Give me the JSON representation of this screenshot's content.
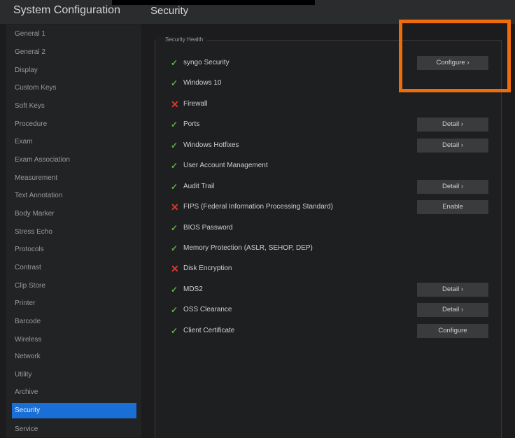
{
  "header": {
    "app_title": "System Configuration",
    "page_title": "Security"
  },
  "sidebar": {
    "active_index": 22,
    "items": [
      {
        "label": "General 1"
      },
      {
        "label": "General 2"
      },
      {
        "label": "Display"
      },
      {
        "label": "Custom Keys"
      },
      {
        "label": "Soft Keys"
      },
      {
        "label": "Procedure"
      },
      {
        "label": "Exam"
      },
      {
        "label": "Exam Association"
      },
      {
        "label": "Measurement"
      },
      {
        "label": "Text Annotation"
      },
      {
        "label": "Body Marker"
      },
      {
        "label": "Stress Echo"
      },
      {
        "label": "Protocols"
      },
      {
        "label": "Contrast"
      },
      {
        "label": "Clip Store"
      },
      {
        "label": "Printer"
      },
      {
        "label": "Barcode"
      },
      {
        "label": "Wireless"
      },
      {
        "label": "Network"
      },
      {
        "label": "Utility"
      },
      {
        "label": "Archive"
      },
      {
        "label": "Security"
      },
      {
        "label": "Service"
      }
    ]
  },
  "security_health": {
    "section_label": "Security Health",
    "ok_icon": "checkmark-icon",
    "fail_icon": "cross-icon",
    "ok_color": "#5fb13f",
    "fail_color": "#e2362b",
    "rows": [
      {
        "label": "syngo Security",
        "status": "ok",
        "button": "Configure ›"
      },
      {
        "label": "Windows 10",
        "status": "ok",
        "button": ""
      },
      {
        "label": "Firewall",
        "status": "fail",
        "button": ""
      },
      {
        "label": "Ports",
        "status": "ok",
        "button": "Detail ›"
      },
      {
        "label": "Windows Hotfixes",
        "status": "ok",
        "button": "Detail ›"
      },
      {
        "label": "User Account Management",
        "status": "ok",
        "button": ""
      },
      {
        "label": "Audit Trail",
        "status": "ok",
        "button": "Detail ›"
      },
      {
        "label": "FIPS (Federal Information Processing Standard)",
        "status": "fail",
        "button": "Enable"
      },
      {
        "label": "BIOS Password",
        "status": "ok",
        "button": ""
      },
      {
        "label": "Memory Protection (ASLR, SEHOP, DEP)",
        "status": "ok",
        "button": ""
      },
      {
        "label": "Disk Encryption",
        "status": "fail",
        "button": ""
      },
      {
        "label": "MDS2",
        "status": "ok",
        "button": "Detail ›"
      },
      {
        "label": "OSS Clearance",
        "status": "ok",
        "button": "Detail ›"
      },
      {
        "label": "Client Certificate",
        "status": "ok",
        "button": "Configure"
      }
    ]
  },
  "accent_color": "#1a6fd6",
  "highlight_color": "#ee6c0a"
}
